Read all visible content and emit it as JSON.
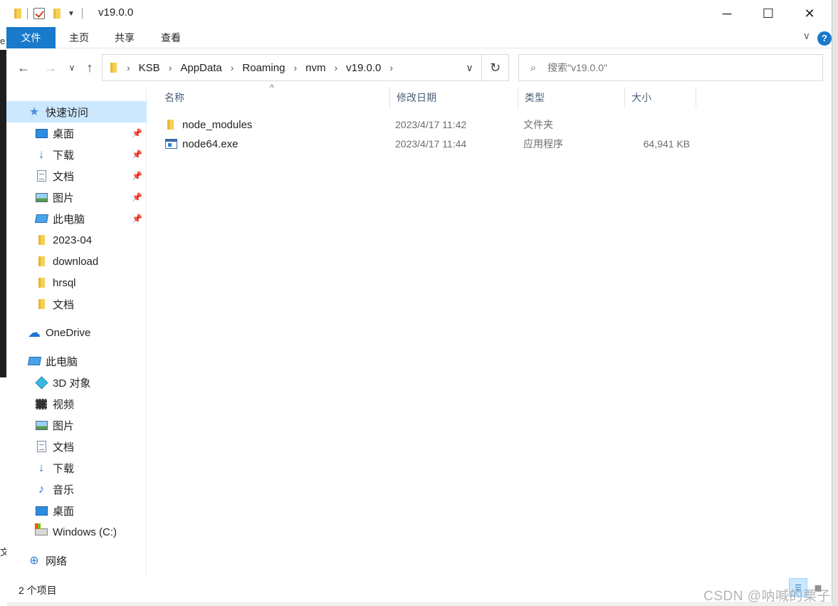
{
  "window": {
    "title": "v19.0.0",
    "controls": {
      "minimize": "─",
      "maximize": "☐",
      "close": "✕"
    }
  },
  "background": {
    "left_char_top": "e",
    "left_char_bottom": "文"
  },
  "ribbon": {
    "tabs": [
      "文件",
      "主页",
      "共享",
      "查看"
    ],
    "help": "?"
  },
  "address": {
    "crumbs": [
      "KSB",
      "AppData",
      "Roaming",
      "nvm",
      "v19.0.0"
    ]
  },
  "search": {
    "placeholder": "搜索\"v19.0.0\""
  },
  "sidebar": {
    "items": [
      {
        "label": "快速访问",
        "icon": "star-icon",
        "selected": true,
        "pinned": false
      },
      {
        "label": "桌面",
        "icon": "desktop-icon",
        "pinned": true
      },
      {
        "label": "下载",
        "icon": "download-icon",
        "pinned": true
      },
      {
        "label": "文档",
        "icon": "document-icon",
        "pinned": true
      },
      {
        "label": "图片",
        "icon": "picture-icon",
        "pinned": true
      },
      {
        "label": "此电脑",
        "icon": "computer-icon",
        "pinned": true
      },
      {
        "label": "2023-04",
        "icon": "folder-icon",
        "pinned": false
      },
      {
        "label": "download",
        "icon": "folder-icon",
        "pinned": false
      },
      {
        "label": "hrsql",
        "icon": "folder-icon",
        "pinned": false
      },
      {
        "label": "文档",
        "icon": "folder-icon",
        "pinned": false
      },
      {
        "label": "OneDrive",
        "icon": "cloud-icon",
        "pinned": false
      },
      {
        "label": "此电脑",
        "icon": "computer-icon",
        "pinned": false
      },
      {
        "label": "3D 对象",
        "icon": "3d-objects-icon",
        "pinned": false
      },
      {
        "label": "视频",
        "icon": "video-icon",
        "pinned": false
      },
      {
        "label": "图片",
        "icon": "picture-icon",
        "pinned": false
      },
      {
        "label": "文档",
        "icon": "document-icon",
        "pinned": false
      },
      {
        "label": "下载",
        "icon": "download-icon",
        "pinned": false
      },
      {
        "label": "音乐",
        "icon": "music-icon",
        "pinned": false
      },
      {
        "label": "桌面",
        "icon": "desktop-icon",
        "pinned": false
      },
      {
        "label": "Windows (C:)",
        "icon": "drive-icon",
        "pinned": false
      },
      {
        "label": "网络",
        "icon": "network-icon",
        "pinned": false
      }
    ]
  },
  "columns": {
    "name": "名称",
    "modified": "修改日期",
    "type": "类型",
    "size": "大小"
  },
  "files": [
    {
      "name": "node_modules",
      "modified": "2023/4/17 11:42",
      "type": "文件夹",
      "size": "",
      "icon": "folder-icon"
    },
    {
      "name": "node64.exe",
      "modified": "2023/4/17 11:44",
      "type": "应用程序",
      "size": "64,941 KB",
      "icon": "exe-icon"
    }
  ],
  "status": {
    "count": "2 个项目"
  },
  "watermark": "CSDN @呐喊的栗子",
  "colors": {
    "accent": "#1979ca",
    "selection": "#cce8ff"
  }
}
